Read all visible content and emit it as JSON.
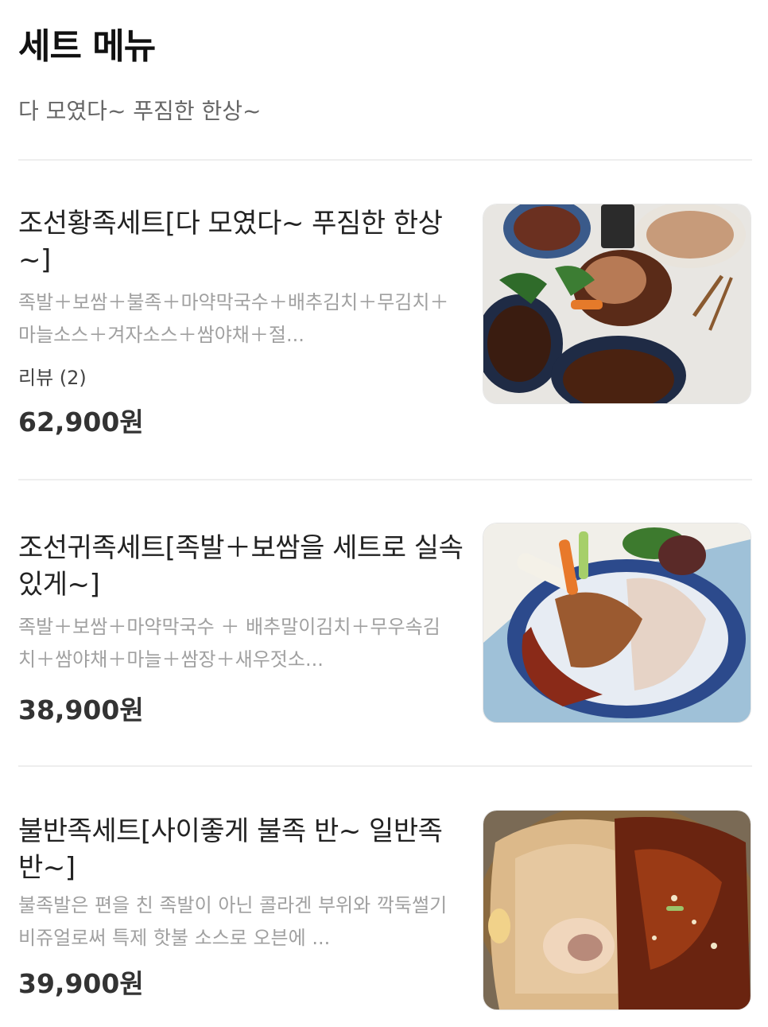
{
  "section": {
    "title": "세트 메뉴",
    "subtitle": "다 모였다~ 푸짐한 한상~"
  },
  "items": [
    {
      "name": "조선황족세트[다 모였다~ 푸짐한 한상~]",
      "description": "족발＋보쌈＋불족＋마약막국수＋배추김치＋무김치＋마늘소스＋겨자소스＋쌈야채＋절...",
      "review": "리뷰 (2)",
      "price": "62,900원",
      "image_icon": "food-photo-icon"
    },
    {
      "name": "조선귀족세트[족발＋보쌈을 세트로 실속있게~]",
      "description": "족발＋보쌈＋마약막국수 ＋ 배추말이김치＋무우속김치＋쌈야채＋마늘＋쌈장＋새우젓소...",
      "price": "38,900원",
      "image_icon": "food-photo-icon"
    },
    {
      "name": "불반족세트[사이좋게 불족 반~ 일반족 반~]",
      "description": "불족발은 편을 친 족발이 아닌 콜라겐 부위와 깍둑썰기 비쥬얼로써 특제 핫불 소스로 오븐에 ...",
      "price": "39,900원",
      "image_icon": "food-photo-icon"
    }
  ]
}
